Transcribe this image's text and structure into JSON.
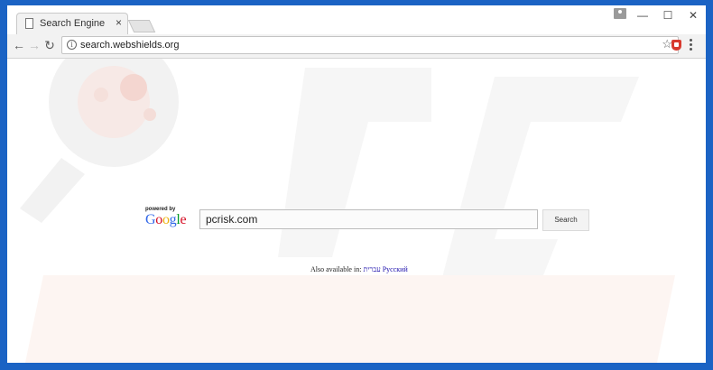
{
  "tab": {
    "title": "Search Engine",
    "close_glyph": "×"
  },
  "window_controls": {
    "minimize": "—",
    "maximize": "☐",
    "close": "✕"
  },
  "toolbar": {
    "back_glyph": "←",
    "forward_glyph": "→",
    "reload_glyph": "↻",
    "url": "search.webshields.org",
    "star_glyph": "☆"
  },
  "search": {
    "powered_by": "powered by",
    "google_letters": [
      {
        "ch": "G",
        "color": "#3369e8"
      },
      {
        "ch": "o",
        "color": "#d50f25"
      },
      {
        "ch": "o",
        "color": "#eeb211"
      },
      {
        "ch": "g",
        "color": "#3369e8"
      },
      {
        "ch": "l",
        "color": "#009925"
      },
      {
        "ch": "e",
        "color": "#d50f25"
      }
    ],
    "query": "pcrisk.com",
    "button_label": "Search"
  },
  "languages": {
    "prefix": "Also available in:",
    "hebrew": "עברית",
    "russian": "Русский"
  },
  "colors": {
    "desktop": "#1b63c4",
    "link": "#1a0dab"
  }
}
